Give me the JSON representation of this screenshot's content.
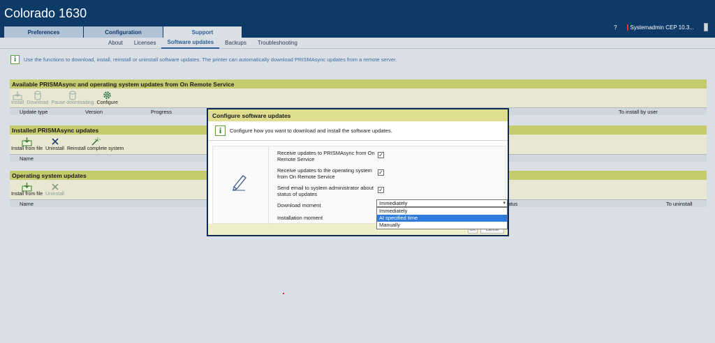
{
  "app": {
    "title": "Colorado 1630"
  },
  "tabs": [
    {
      "label": "Preferences"
    },
    {
      "label": "Configuration"
    },
    {
      "label": "Support"
    }
  ],
  "header_right": {
    "help": "?",
    "user": "Systemadmin CEP 10.3..."
  },
  "subtabs": [
    "About",
    "Licenses",
    "Software updates",
    "Backups",
    "Troubleshooting"
  ],
  "info": {
    "text": "Use the functions to download, install, reinstall or uninstall software updates. The printer can automatically download PRISMAsync updates from a remote server."
  },
  "panel_available": {
    "title": "Available PRISMAsync and operating system updates from On Remote Service",
    "tools": [
      "Install",
      "Download",
      "Pause downloading",
      "Configure"
    ],
    "columns": [
      "Update type",
      "Version",
      "Progress",
      "To install by user"
    ]
  },
  "panel_installed": {
    "title": "Installed PRISMAsync updates",
    "tools": [
      "Install from file",
      "Uninstall",
      "Reinstall complete system"
    ],
    "columns": [
      "Name"
    ]
  },
  "panel_os": {
    "title": "Operating system updates",
    "tools": [
      "Install from file",
      "Uninstall"
    ],
    "columns": [
      "Name",
      "Status",
      "To uninstall"
    ]
  },
  "dialog": {
    "title": "Configure software updates",
    "info": "Configure how you want to download and install the software updates.",
    "row1": "Receive updates to PRISMAsync from On Remote Service",
    "row2": "Receive updates to the operating system from On Remote Service",
    "row3": "Send email to system administrator about status of updates",
    "download_label": "Download moment",
    "install_label": "Installation moment",
    "select_value": "Immediately",
    "options": [
      "Immediately",
      "At specified time",
      "Manually"
    ],
    "buttons": [
      "OK",
      "Cancel"
    ]
  },
  "colors": {
    "header": "#0e3a68",
    "panel_head": "#c6cb6e",
    "select_highlight": "#2f7bdc"
  }
}
